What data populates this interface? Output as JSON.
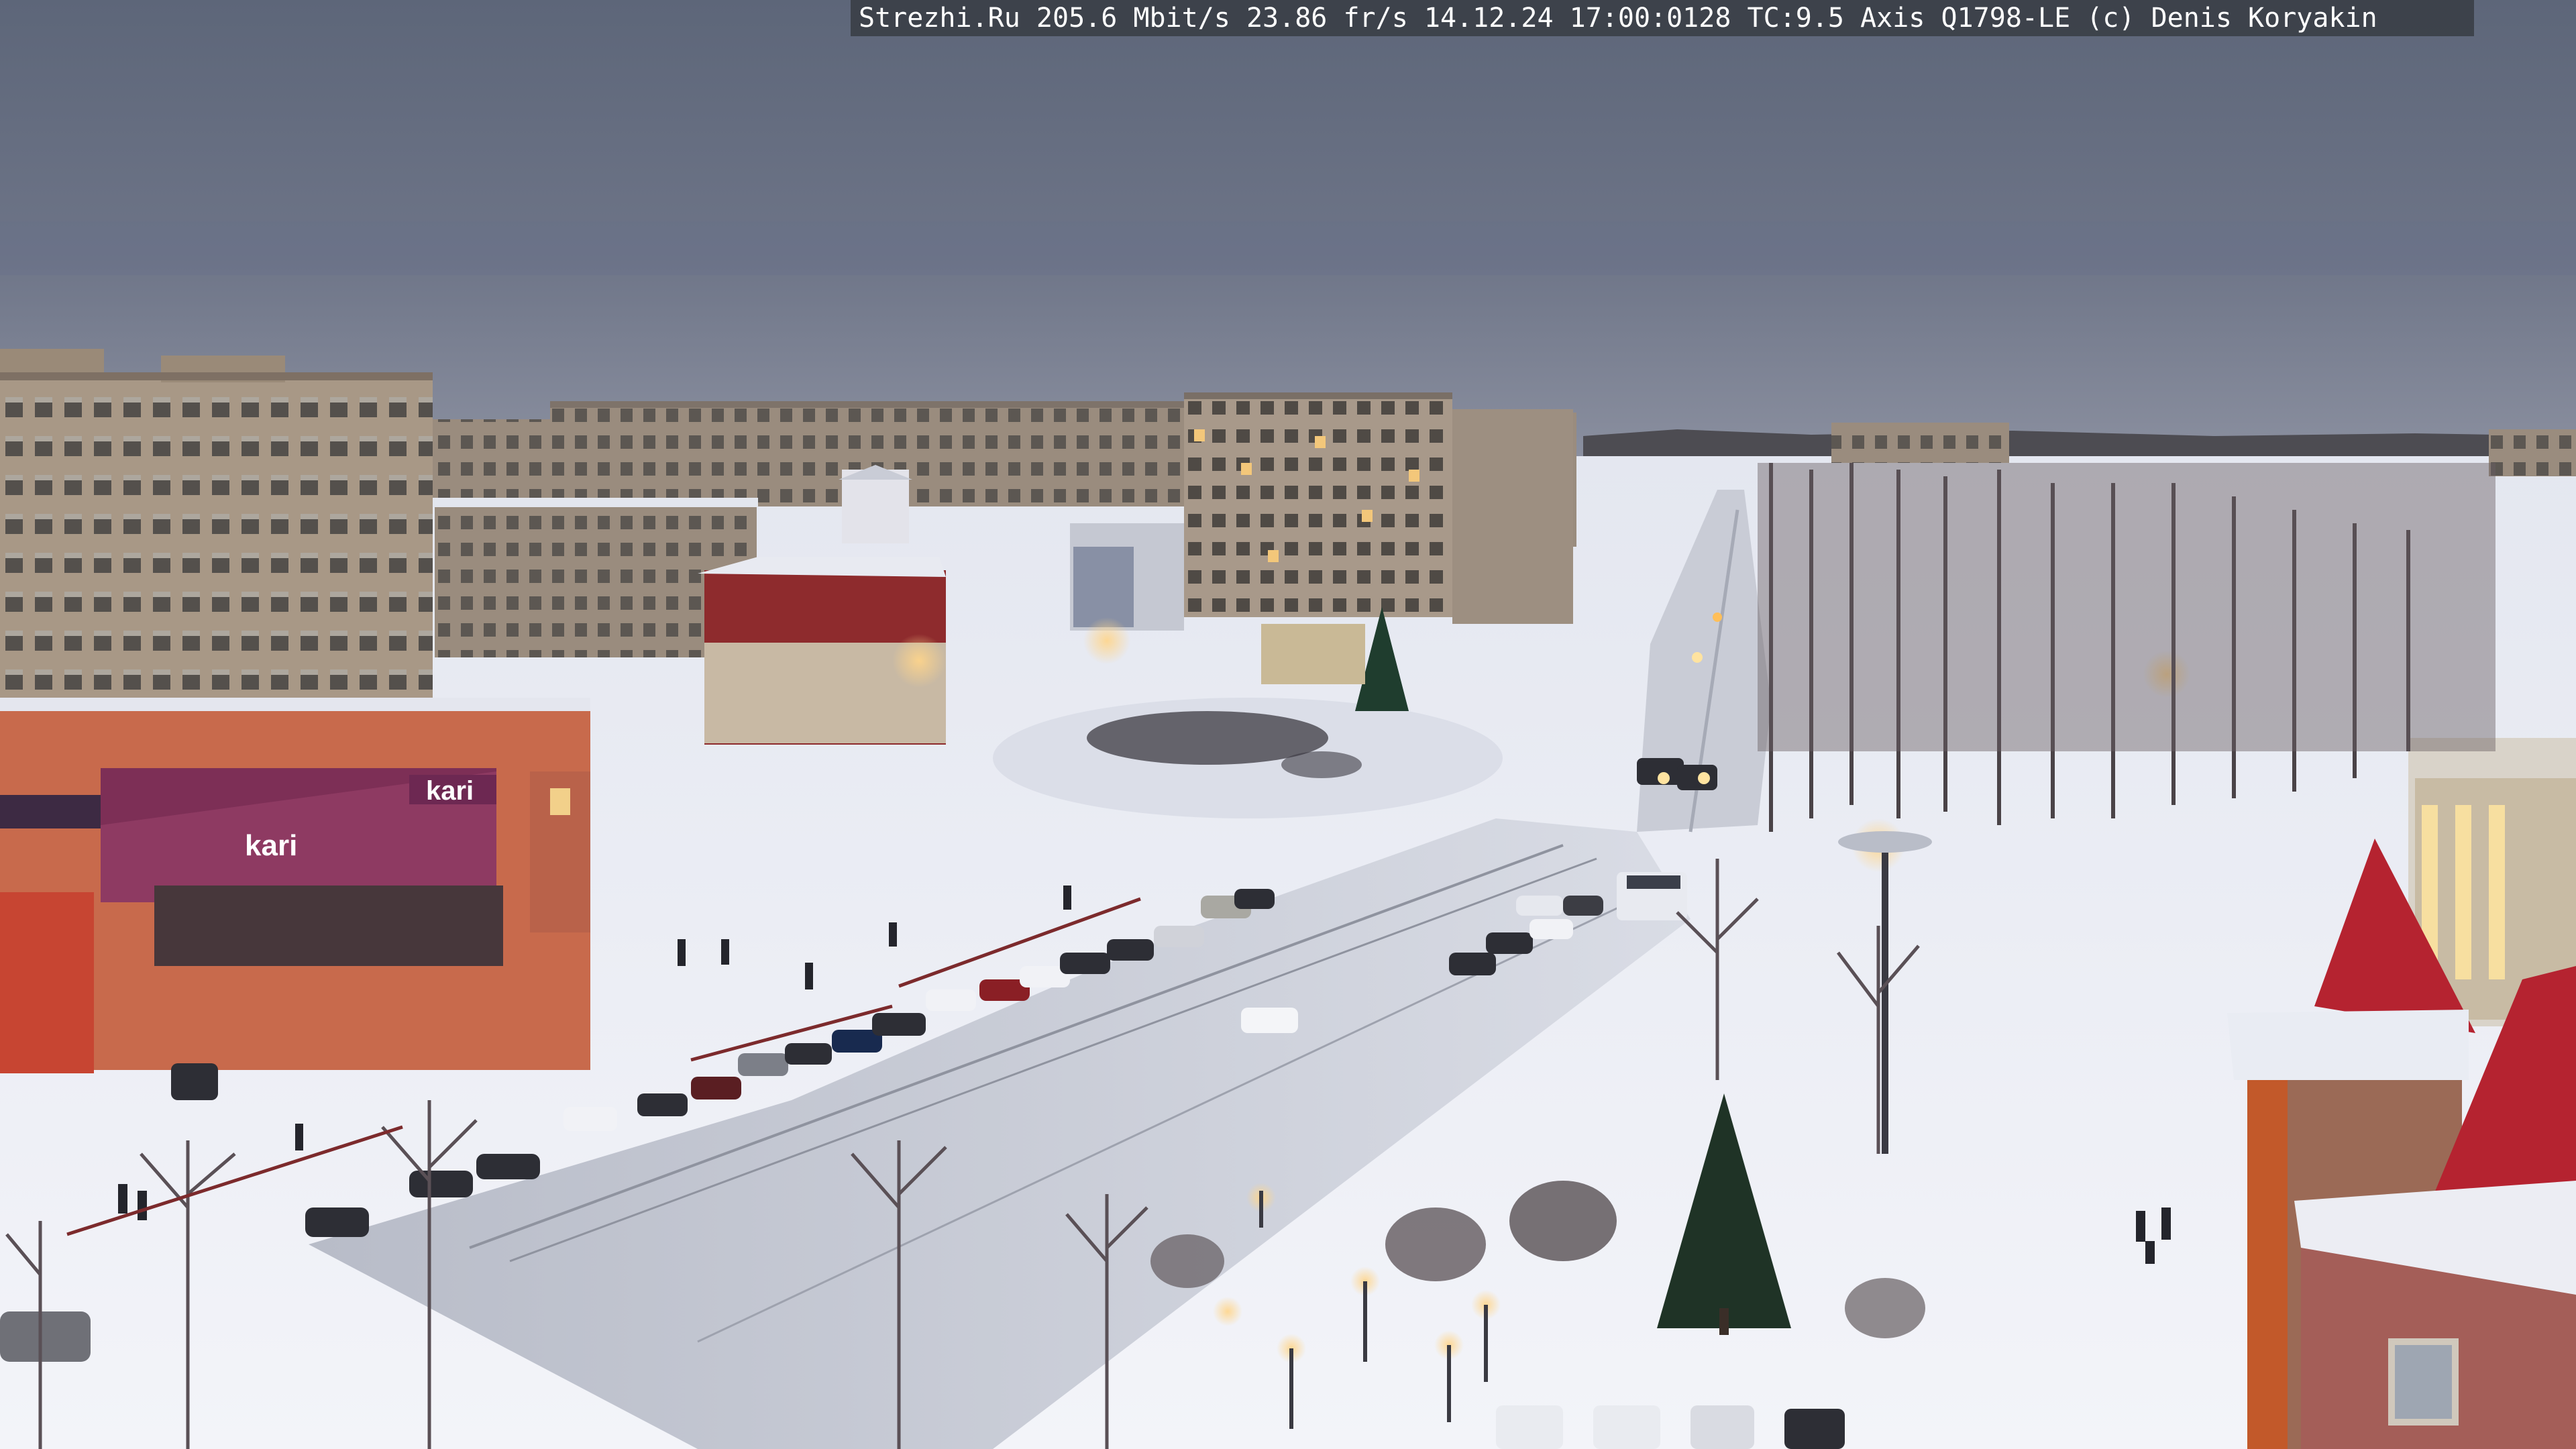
{
  "camera_overlay": {
    "text": "Strezhi.Ru 205.6 Mbit/s 23.86 fr/s 14.12.24 17:00:0128 TC:9.5  Axis Q1798-LE  (c) Denis Koryakin"
  },
  "signage": {
    "kari_small": "kari",
    "kari_large": "kari"
  }
}
